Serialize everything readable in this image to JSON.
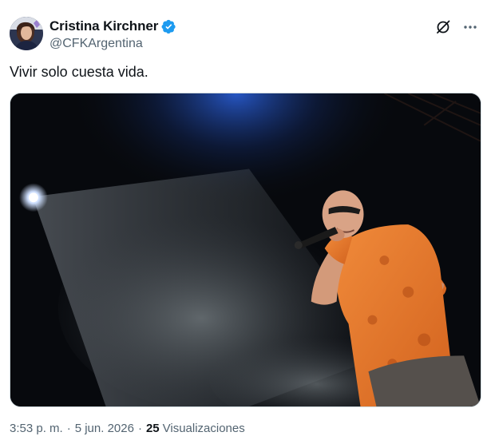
{
  "author": {
    "display_name": "Cristina Kirchner",
    "handle": "@CFKArgentina",
    "verified_color": "#1d9bf0"
  },
  "tweet": {
    "text": "Vivir solo cuesta vida."
  },
  "meta": {
    "time": "3:53 p. m.",
    "separator": "·",
    "date": "5 jun. 2026",
    "views_count": "25",
    "views_label": "Visualizaciones"
  },
  "icons": {
    "grok": "grok-slash-icon",
    "more": "more-horizontal-icon",
    "verified": "verified-badge-icon"
  }
}
